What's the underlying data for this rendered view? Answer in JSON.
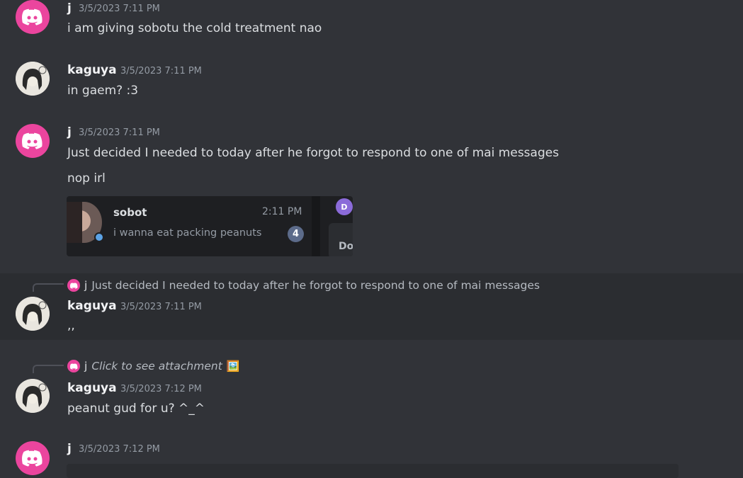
{
  "messages": [
    {
      "author": "j",
      "timestamp": "3/5/2023 7:11 PM",
      "lines": [
        "i am giving sobotu the cold treatment nao"
      ]
    },
    {
      "author": "kaguya",
      "timestamp": "3/5/2023 7:11 PM",
      "lines": [
        "in gaem? :3"
      ]
    },
    {
      "author": "j",
      "timestamp": "3/5/2023 7:11 PM",
      "lines": [
        "Just decided I needed to today after he forgot to respond to one of mai messages",
        "nop irl"
      ],
      "attachment": {
        "name": "sobot",
        "time": "2:11 PM",
        "preview": "i wanna eat packing peanuts",
        "badge": "4",
        "side_letter": "D",
        "side_text": "Do"
      }
    },
    {
      "author": "kaguya",
      "timestamp": "3/5/2023 7:11 PM",
      "lines": [
        ",,"
      ],
      "reply": {
        "author": "j",
        "text": "Just decided I needed to today after he forgot to respond to one of mai messages"
      }
    },
    {
      "author": "kaguya",
      "timestamp": "3/5/2023 7:12 PM",
      "lines": [
        "peanut gud for u? ^_^"
      ],
      "reply": {
        "author": "j",
        "text": "Click to see attachment",
        "icon": "🖼️"
      }
    },
    {
      "author": "j",
      "timestamp": "3/5/2023 7:12 PM",
      "lines": []
    }
  ],
  "colors": {
    "background": "#313338",
    "highlight": "#2b2d31",
    "brand": "#eb459e"
  },
  "icons": {
    "discord_avatar": "discord-logo-icon",
    "reply_image": "image-icon"
  }
}
